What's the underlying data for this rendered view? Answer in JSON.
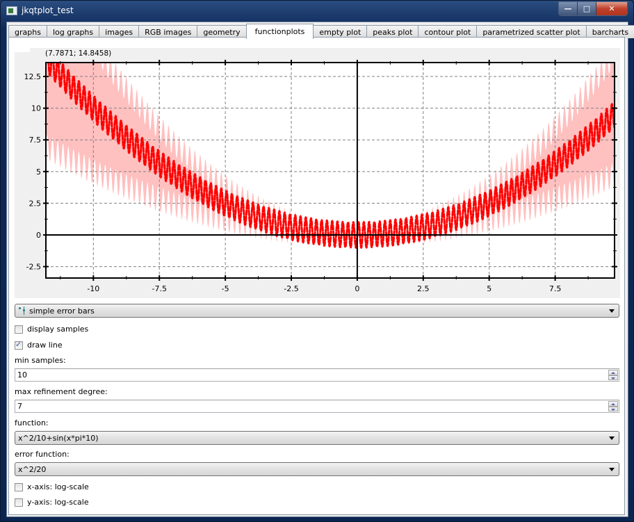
{
  "window": {
    "title": "jkqtplot_test",
    "controls": {
      "minimize": "—",
      "maximize": "□",
      "close": "✕"
    }
  },
  "tabs": [
    {
      "label": "graphs",
      "active": false
    },
    {
      "label": "log graphs",
      "active": false
    },
    {
      "label": "images",
      "active": false
    },
    {
      "label": "RGB images",
      "active": false
    },
    {
      "label": "geometry",
      "active": false
    },
    {
      "label": "functionplots",
      "active": true
    },
    {
      "label": "empty plot",
      "active": false
    },
    {
      "label": "peaks plot",
      "active": false
    },
    {
      "label": "contour plot",
      "active": false
    },
    {
      "label": "parametrized scatter plot",
      "active": false
    },
    {
      "label": "barcharts",
      "active": false
    }
  ],
  "plot": {
    "mouse_position": "(7.7871; 14.8458)"
  },
  "chart_data": {
    "type": "line",
    "title": "",
    "xlabel": "",
    "ylabel": "",
    "xlim": [
      -11.8,
      9.75
    ],
    "ylim": [
      -3.4,
      13.6
    ],
    "xticks": [
      -10,
      -7.5,
      -5,
      -2.5,
      0,
      2.5,
      5,
      7.5
    ],
    "xtick_labels": [
      "-10",
      "-7.5",
      "-5",
      "-2.5",
      "0",
      "2.5",
      "5",
      "7.5"
    ],
    "yticks": [
      -2.5,
      0,
      2.5,
      5,
      7.5,
      10,
      12.5
    ],
    "ytick_labels": [
      "-2.5",
      "0",
      "2.5",
      "5",
      "7.5",
      "10",
      "12.5"
    ],
    "grid": true,
    "series": [
      {
        "name": "x^2/10+sin(x*pi*10)",
        "function": "x^2/10+sin(x*pi*10)",
        "error_function": "x^2/20",
        "error_style": "simple error bars",
        "line_color": "#ff0000",
        "error_color": "#ffc0c0"
      }
    ],
    "legend": "none"
  },
  "controls": {
    "error_style": {
      "value": "simple error bars",
      "icon": "error-bars-icon"
    },
    "display_samples": {
      "label": "display samples",
      "checked": false
    },
    "draw_line": {
      "label": "draw line",
      "checked": true
    },
    "min_samples": {
      "label": "min samples:",
      "value": "10"
    },
    "max_refinement": {
      "label": "max refinement degree:",
      "value": "7"
    },
    "function": {
      "label": "function:",
      "value": "x^2/10+sin(x*pi*10)"
    },
    "error_function": {
      "label": "error function:",
      "value": "x^2/20"
    },
    "x_log": {
      "label": "x-axis: log-scale",
      "checked": false
    },
    "y_log": {
      "label": "y-axis: log-scale",
      "checked": false
    }
  }
}
